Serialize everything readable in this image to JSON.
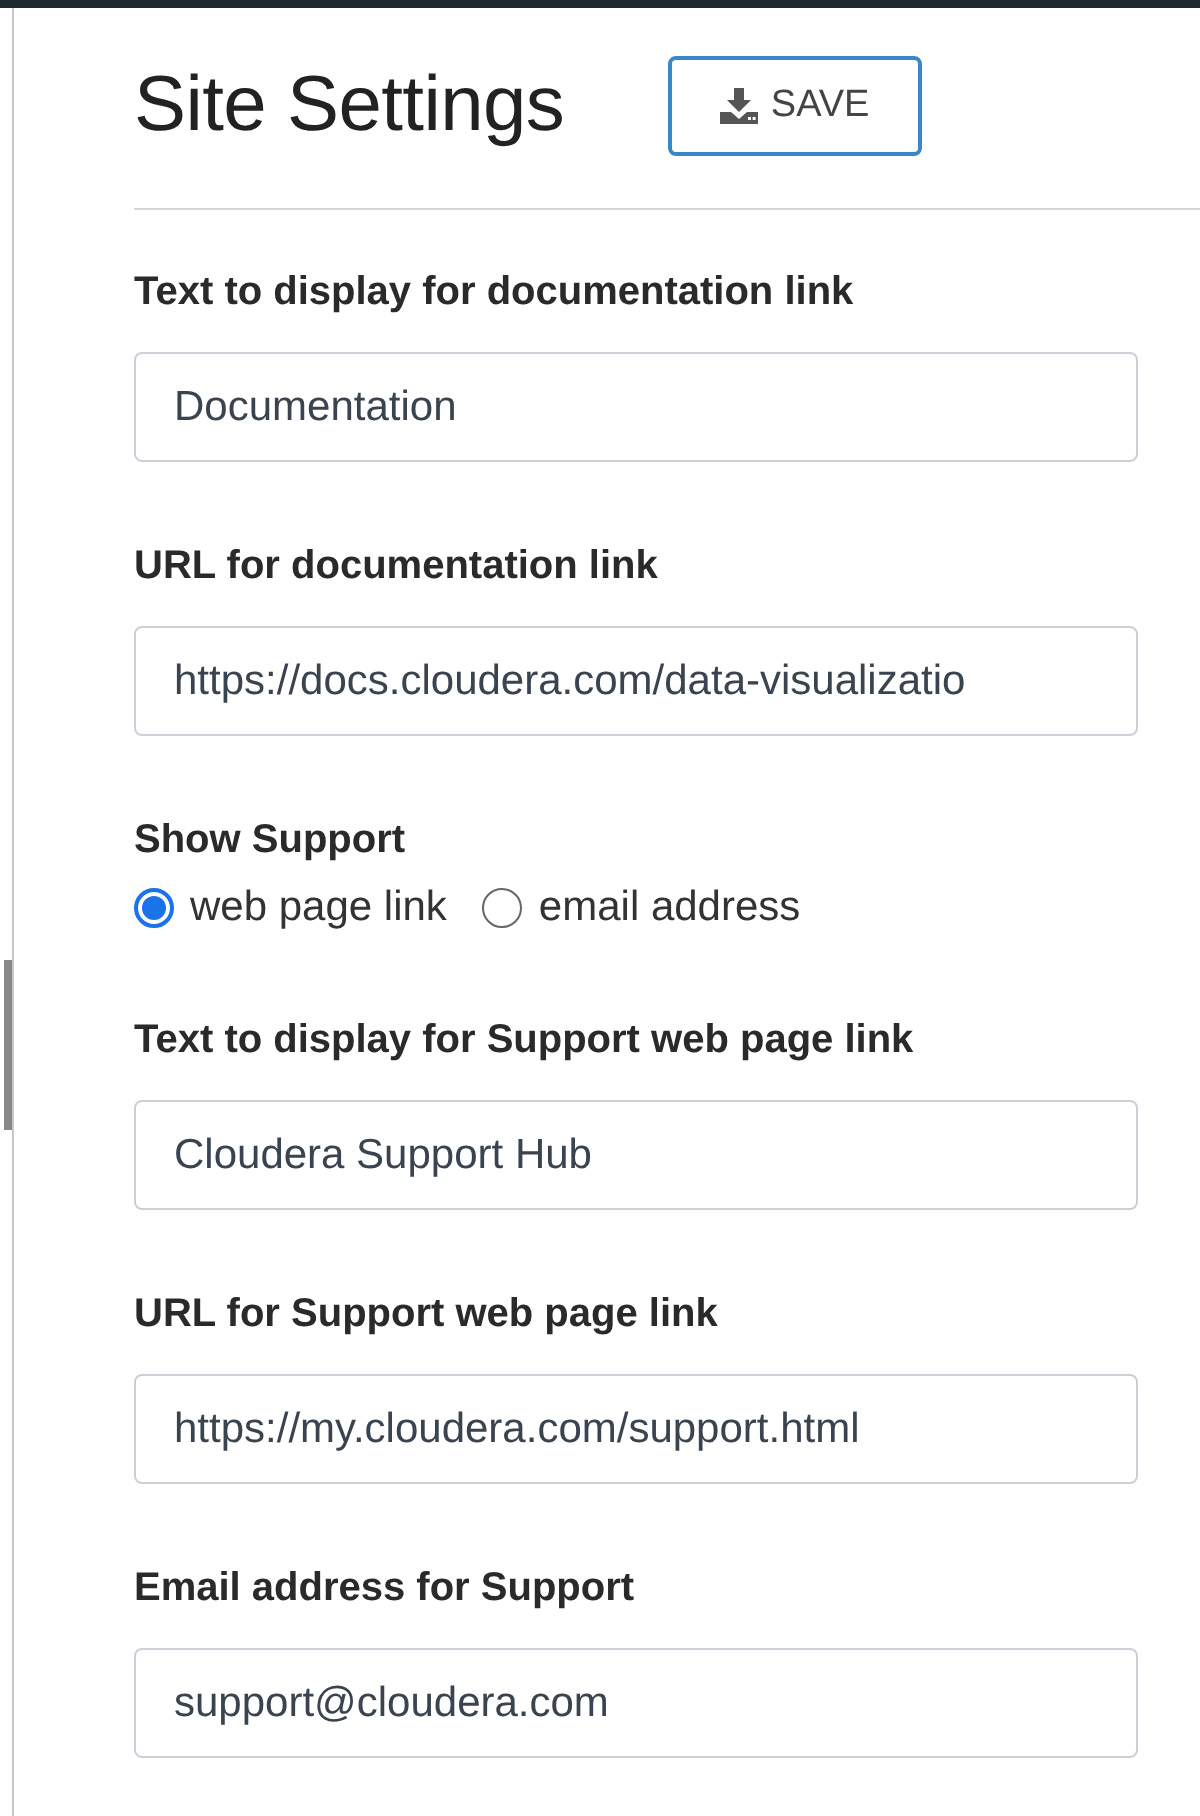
{
  "title": "Site Settings",
  "save_button": {
    "label": "SAVE"
  },
  "fields": [
    {
      "kind": "text",
      "label": "Text to display for documentation link",
      "value": "Documentation"
    },
    {
      "kind": "text",
      "label": "URL for documentation link",
      "value": "https://docs.cloudera.com/data-visualizatio"
    },
    {
      "kind": "radio",
      "label": "Show Support",
      "options": [
        {
          "label": "web page link",
          "selected": true
        },
        {
          "label": "email address",
          "selected": false
        }
      ]
    },
    {
      "kind": "text",
      "label": "Text to display for Support web page link",
      "value": "Cloudera Support Hub"
    },
    {
      "kind": "text",
      "label": "URL for Support web page link",
      "value": "https://my.cloudera.com/support.html"
    },
    {
      "kind": "text",
      "label": "Email address for Support",
      "value": "support@cloudera.com"
    }
  ]
}
